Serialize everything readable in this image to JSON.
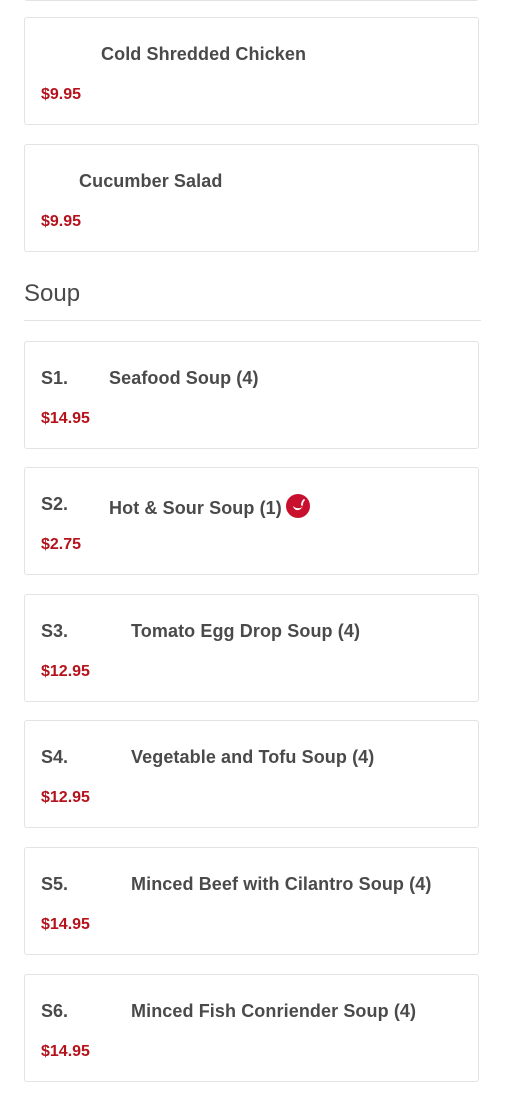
{
  "menu": {
    "top_items": [
      {
        "name": "Cold Shredded Chicken",
        "price": "$9.95"
      },
      {
        "name": "Cucumber Salad",
        "price": "$9.95"
      }
    ],
    "section": {
      "title": "Soup",
      "items": [
        {
          "code": "S1.",
          "name": "Seafood Soup (4)",
          "price": "$14.95",
          "spicy": false
        },
        {
          "code": "S2.",
          "name": "Hot & Sour Soup (1)",
          "price": "$2.75",
          "spicy": true
        },
        {
          "code": "S3.",
          "name": "Tomato Egg Drop Soup (4)",
          "price": "$12.95",
          "spicy": false
        },
        {
          "code": "S4.",
          "name": "Vegetable and Tofu Soup (4)",
          "price": "$12.95",
          "spicy": false
        },
        {
          "code": "S5.",
          "name": "Minced Beef with Cilantro Soup (4)",
          "price": "$14.95",
          "spicy": false
        },
        {
          "code": "S6.",
          "name": "Minced Fish Conriender Soup (4)",
          "price": "$14.95",
          "spicy": false
        }
      ]
    }
  },
  "icons": {
    "spicy": "chili-pepper-icon"
  },
  "colors": {
    "price": "#b5121b",
    "text": "#4a4a4a",
    "border": "#e3e3e3",
    "spicy_badge": "#c8102e"
  }
}
